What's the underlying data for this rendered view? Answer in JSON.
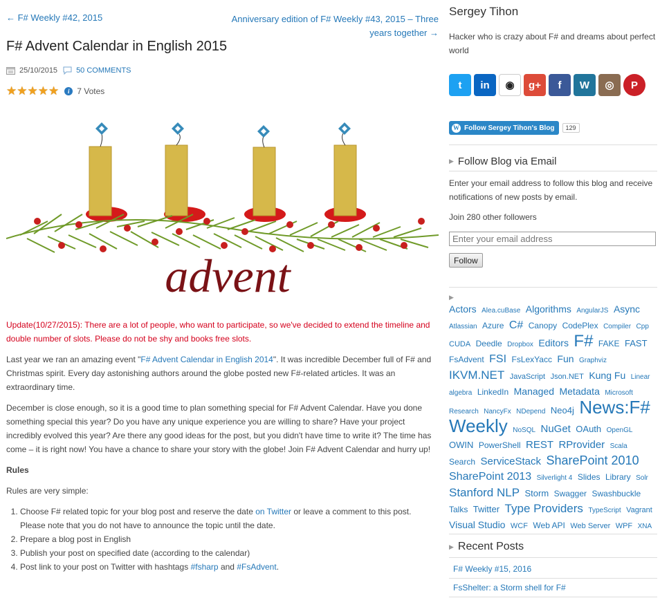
{
  "post": {
    "prev_link": "← F# Weekly #42, 2015",
    "next_link": "Anniversary edition of F# Weekly #43, 2015 – Three years together →",
    "title": "F# Advent Calendar in English 2015",
    "date": "25/10/2015",
    "comments": "50 COMMENTS",
    "votes": "7 Votes",
    "stars": 5,
    "image_word": "advent"
  },
  "content": {
    "update": "Update(10/27/2015): There are a lot of people, who want to participate, so we've decided to extend the timeline and double number of slots. Please do not be shy and books free slots.",
    "p1_pre": "Last year we ran an amazing event \"",
    "p1_link": "F# Advent Calendar in English 2014",
    "p1_post": "\". It was incredible December full of F# and Christmas spirit. Every day astonishing authors around the globe posted new F#-related articles. It was an extraordinary time.",
    "p2": "December is close enough, so it is a good time to plan something special for F# Advent Calendar. Have you done something special this year? Do you have any unique experience you are willing to share? Have your project incredibly evolved this year? Are there any good ideas for the post, but you didn't have time to write it? The time has come – it is right now! You have a chance to share your story with the globe! Join F# Advent Calendar and hurry up!",
    "rules_heading": "Rules",
    "rules_intro": "Rules are very simple:",
    "rule1_pre": "Choose F# related topic for your blog post and reserve the date ",
    "rule1_link": "on Twitter",
    "rule1_post": " or leave a comment to this post. Please note that you do not have to announce the topic until the date.",
    "rule2": "Prepare a blog post in English",
    "rule3": "Publish your post on specified date (according to the calendar)",
    "rule4_pre": "Post link to your post on Twitter with hashtags ",
    "rule4_tag1": "#fsharp",
    "rule4_and": " and ",
    "rule4_tag2": "#FsAdvent",
    "rule4_end": "."
  },
  "sidebar": {
    "author": "Sergey Tihon",
    "bio": "Hacker who is crazy about F# and dreams about perfect world",
    "social": [
      {
        "icon": "twitter-icon",
        "glyph": "t",
        "color": "#1da1f2"
      },
      {
        "icon": "linkedin-icon",
        "glyph": "in",
        "color": "#0a66c2"
      },
      {
        "icon": "github-icon",
        "glyph": "◉",
        "color": "#ffffff"
      },
      {
        "icon": "googleplus-icon",
        "glyph": "g+",
        "color": "#dd4b39"
      },
      {
        "icon": "facebook-icon",
        "glyph": "f",
        "color": "#3b5998"
      },
      {
        "icon": "wordpress-icon",
        "glyph": "W",
        "color": "#21759b"
      },
      {
        "icon": "instagram-icon",
        "glyph": "◎",
        "color": "#8a6c52"
      },
      {
        "icon": "pinterest-icon",
        "glyph": "P",
        "color": "#cb2027"
      }
    ],
    "follow_button": "Follow Sergey Tihon's Blog",
    "follow_count": "129",
    "follow_title": "Follow Blog via Email",
    "follow_text": "Enter your email address to follow this blog and receive notifications of new posts by email.",
    "join_text": "Join 280 other followers",
    "email_placeholder": "Enter your email address",
    "follow_submit": "Follow",
    "tags": [
      {
        "t": "Actors",
        "s": 14
      },
      {
        "t": "Alea.cuBase",
        "s": 10
      },
      {
        "t": "Algorithms",
        "s": 14
      },
      {
        "t": "AngularJS",
        "s": 10
      },
      {
        "t": "Async",
        "s": 14
      },
      {
        "t": "Atlassian",
        "s": 10
      },
      {
        "t": "Azure",
        "s": 12
      },
      {
        "t": "C#",
        "s": 16
      },
      {
        "t": "Canopy",
        "s": 12
      },
      {
        "t": "CodePlex",
        "s": 12
      },
      {
        "t": "Compiler",
        "s": 10
      },
      {
        "t": "Cpp",
        "s": 10
      },
      {
        "t": "CUDA",
        "s": 11
      },
      {
        "t": "Deedle",
        "s": 12
      },
      {
        "t": "Dropbox",
        "s": 10
      },
      {
        "t": "Editors",
        "s": 14
      },
      {
        "t": "F#",
        "s": 24
      },
      {
        "t": "FAKE",
        "s": 12
      },
      {
        "t": "FAST",
        "s": 13
      },
      {
        "t": "FsAdvent",
        "s": 12
      },
      {
        "t": "FSI",
        "s": 16
      },
      {
        "t": "FsLexYacc",
        "s": 12
      },
      {
        "t": "Fun",
        "s": 14
      },
      {
        "t": "Graphviz",
        "s": 10
      },
      {
        "t": "IKVM.NET",
        "s": 17
      },
      {
        "t": "JavaScript",
        "s": 11
      },
      {
        "t": "Json.NET",
        "s": 11
      },
      {
        "t": "Kung Fu",
        "s": 14
      },
      {
        "t": "Linear algebra",
        "s": 10
      },
      {
        "t": "LinkedIn",
        "s": 12
      },
      {
        "t": "Managed",
        "s": 14
      },
      {
        "t": "Metadata",
        "s": 14
      },
      {
        "t": "Microsoft Research",
        "s": 10
      },
      {
        "t": "NancyFx",
        "s": 10
      },
      {
        "t": "NDepend",
        "s": 10
      },
      {
        "t": "Neo4j",
        "s": 13
      },
      {
        "t": "News:F# Weekly",
        "s": 26
      },
      {
        "t": "NoSQL",
        "s": 10
      },
      {
        "t": "NuGet",
        "s": 15
      },
      {
        "t": "OAuth",
        "s": 13
      },
      {
        "t": "OpenGL",
        "s": 10
      },
      {
        "t": "OWIN",
        "s": 13
      },
      {
        "t": "PowerShell",
        "s": 12
      },
      {
        "t": "REST",
        "s": 15
      },
      {
        "t": "RProvider",
        "s": 15
      },
      {
        "t": "Scala",
        "s": 10
      },
      {
        "t": "Search",
        "s": 12
      },
      {
        "t": "ServiceStack",
        "s": 15
      },
      {
        "t": "SharePoint 2010",
        "s": 18
      },
      {
        "t": "SharePoint 2013",
        "s": 16
      },
      {
        "t": "Silverlight 4",
        "s": 10
      },
      {
        "t": "Slides",
        "s": 12
      },
      {
        "t": "Library",
        "s": 12
      },
      {
        "t": "Solr",
        "s": 10
      },
      {
        "t": "Stanford NLP",
        "s": 17
      },
      {
        "t": "Storm",
        "s": 13
      },
      {
        "t": "Swagger",
        "s": 12
      },
      {
        "t": "Swashbuckle",
        "s": 12
      },
      {
        "t": "Talks",
        "s": 12
      },
      {
        "t": "Twitter",
        "s": 13
      },
      {
        "t": "Type Providers",
        "s": 17
      },
      {
        "t": "TypeScript",
        "s": 10
      },
      {
        "t": "Vagrant",
        "s": 11
      },
      {
        "t": "Visual Studio",
        "s": 14
      },
      {
        "t": "WCF",
        "s": 11
      },
      {
        "t": "Web API",
        "s": 12
      },
      {
        "t": "Web Server",
        "s": 11
      },
      {
        "t": "WPF",
        "s": 11
      },
      {
        "t": "XNA",
        "s": 10
      }
    ],
    "recent_title": "Recent Posts",
    "recent_posts": [
      "F# Weekly #15, 2016",
      "FsShelter: a Storm shell for F#"
    ]
  },
  "colors": {
    "link": "#2578b8",
    "update": "#d4001c",
    "star": "#f0a11f"
  }
}
